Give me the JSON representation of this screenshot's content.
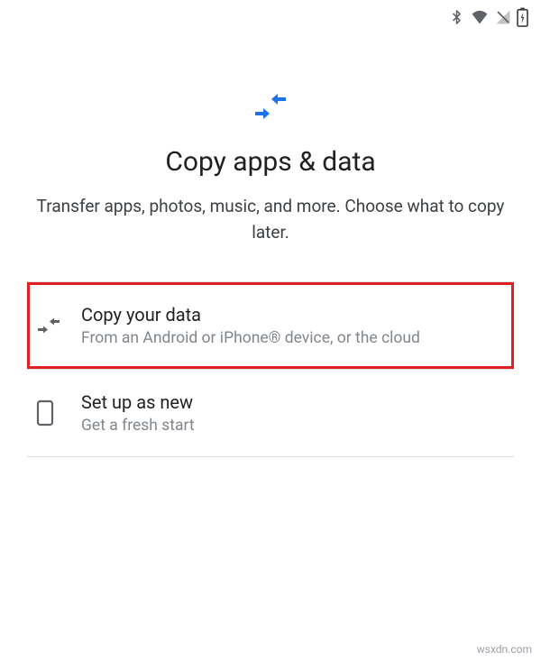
{
  "page": {
    "title": "Copy apps & data",
    "subtitle": "Transfer apps, photos, music, and more. Choose what to copy later."
  },
  "options": {
    "copy": {
      "title": "Copy your data",
      "description": "From an Android or iPhone® device, or the cloud"
    },
    "new": {
      "title": "Set up as new",
      "description": "Get a fresh start"
    }
  },
  "watermark": "wsxdn.com"
}
